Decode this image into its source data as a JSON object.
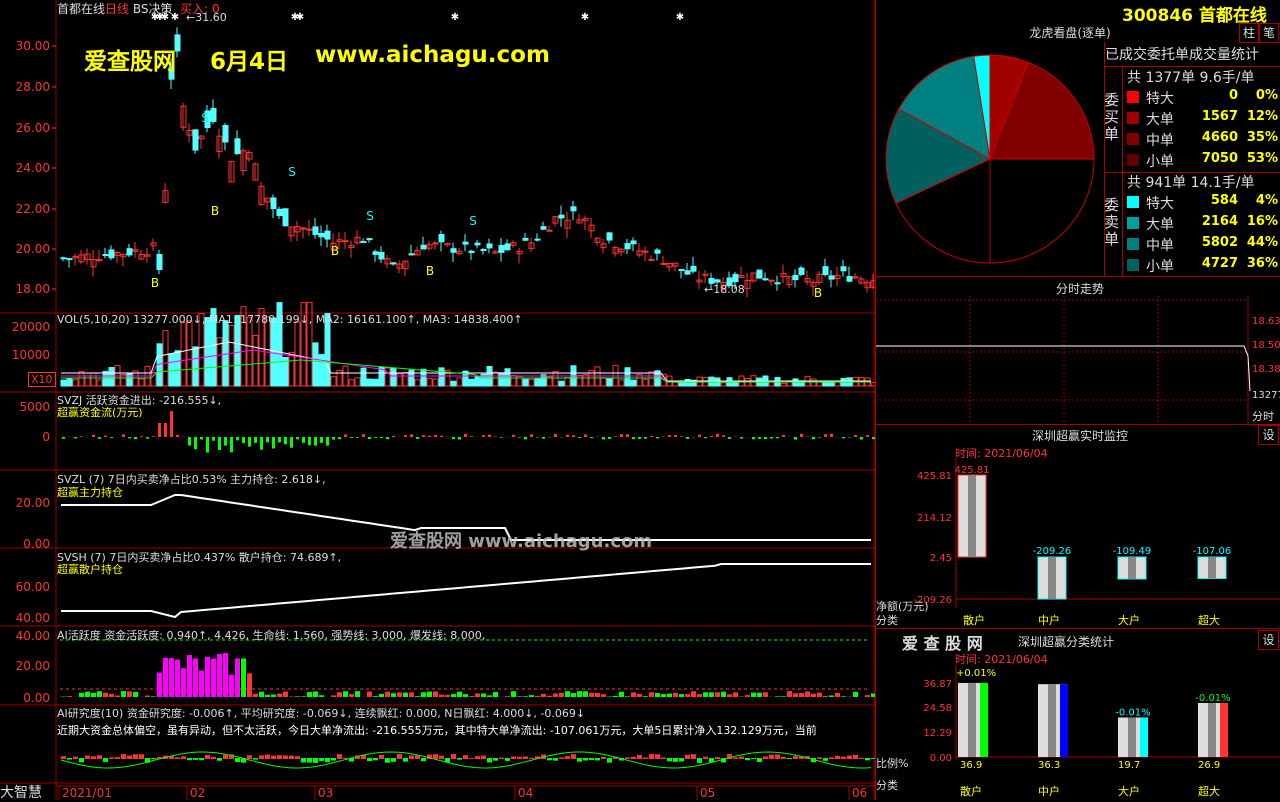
{
  "header": {
    "stock": "首都在线",
    "period": "日线",
    "indicator": "BS决策",
    "buy_label": "买入: 0",
    "price_annot": "31.60",
    "low_annot": "18.08"
  },
  "watermarks": {
    "top_brand": "爱查股网",
    "top_date": "6月4日",
    "top_url": "www.aichagu.com",
    "center": "爱查股网    www.aichagu.com"
  },
  "price_axis": [
    "30.00",
    "28.00",
    "26.00",
    "24.00",
    "22.00",
    "20.00",
    "18.00"
  ],
  "signals": [
    "B",
    "S",
    "B",
    "S",
    "B",
    "S",
    "B",
    "S",
    "B"
  ],
  "vol": {
    "header": "VOL(5,10,20)  13277.000↓, MA1: 17780.199↓, MA2: 16161.100↑, MA3: 14838.400↑",
    "axis": [
      "20000",
      "10000"
    ],
    "unit": "X10"
  },
  "svzj": {
    "header": "SVZJ  活跃资金进出: -216.555↓,",
    "subtitle": "超赢资金流(万元)",
    "axis": [
      "5000",
      "0"
    ]
  },
  "svzl": {
    "header": "SVZL (7) 7日内买卖净占比0.53% 主力持仓: 2.618↓,",
    "subtitle": "超赢主力持仓",
    "axis": [
      "20.00",
      "0.00"
    ]
  },
  "svsh": {
    "header": "SVSH (7) 7日内买卖净占比0.437% 散户持仓: 74.689↑,",
    "subtitle": "超赢散户持仓",
    "axis": [
      "60.00",
      "40.00"
    ]
  },
  "ai1": {
    "header": "AI活跃度  资金活跃度: 0.940↑, 4.426, 生命线: 1.560, 强势线: 3.000, 爆发线: 8.000,",
    "axis": [
      "40.00",
      "20.00",
      "0.00"
    ]
  },
  "ai2": {
    "header": "AI研究度(10)  资金研究度: -0.006↑, 平均研究度: -0.069↓, 连续飘红: 0.000, N日飘红: 4.000↓, -0.069↓",
    "text": "近期大资金总体偏空，虽有异动，但不太活跃，今日大单净流出: -216.555万元，其中特大单净流出: -107.061万元，大单5日累计净入132.129万元，当前"
  },
  "date_axis": [
    "2021/01",
    "02",
    "03",
    "04",
    "05",
    "06"
  ],
  "footer_brand": "大智慧",
  "right": {
    "code": "300846",
    "name": "首都在线",
    "btn1": "柱",
    "btn2": "笔",
    "longhu_title": "龙虎看盘(逐单)",
    "stats_title": "已成交委托单成交量统计",
    "buy": {
      "summary": "共 1377单 9.6手/单",
      "side": "委买单",
      "rows": [
        {
          "name": "特大",
          "n": "0",
          "p": "0%",
          "color": "#ff0000"
        },
        {
          "name": "大单",
          "n": "1567",
          "p": "12%",
          "color": "#a00000"
        },
        {
          "name": "中单",
          "n": "4660",
          "p": "35%",
          "color": "#800000"
        },
        {
          "name": "小单",
          "n": "7050",
          "p": "53%",
          "color": "#600000"
        }
      ]
    },
    "sell": {
      "summary": "共 941单 14.1手/单",
      "side": "委卖单",
      "rows": [
        {
          "name": "特大",
          "n": "584",
          "p": "4%",
          "color": "#00ffff"
        },
        {
          "name": "大单",
          "n": "2164",
          "p": "16%",
          "color": "#00a0a0"
        },
        {
          "name": "中单",
          "n": "5802",
          "p": "44%",
          "color": "#008080"
        },
        {
          "name": "小单",
          "n": "4727",
          "p": "36%",
          "color": "#006060"
        }
      ]
    },
    "fenshi": {
      "title": "分时走势",
      "axis": [
        "18.63",
        "18.50",
        "18.38"
      ],
      "vol": "13277",
      "unit": "分时"
    },
    "monitor": {
      "title": "深圳超赢实时监控",
      "btn": "设",
      "time": "时间: 2021/06/04",
      "axis": [
        "425.81",
        "214.12",
        "2.45",
        "-209.26"
      ],
      "ylabel": "净额(万元)",
      "xlabel": "分类",
      "cats": [
        "散户",
        "中户",
        "大户",
        "超大"
      ],
      "values": [
        425.81,
        -209.26,
        -109.49,
        -107.06
      ],
      "labels": [
        "425.81",
        "-209.26",
        "-109.49",
        "-107.06"
      ]
    },
    "stat": {
      "brand": "爱 查 股 网",
      "title": "深圳超赢分类统计",
      "btn": "设",
      "time": "时间: 2021/06/04",
      "axis": [
        "36.87",
        "24.58",
        "12.29",
        "0.00"
      ],
      "top_label": "+0.01%",
      "ylabel": "比例%",
      "xlabel": "分类",
      "cats": [
        "散户",
        "中户",
        "大户",
        "超大"
      ],
      "values": [
        36.9,
        36.3,
        19.7,
        26.9
      ],
      "labels": [
        "36.9",
        "36.3",
        "19.7",
        "26.9"
      ],
      "pct": [
        "",
        "",
        "-0.01%",
        "-0.01%"
      ]
    }
  }
}
